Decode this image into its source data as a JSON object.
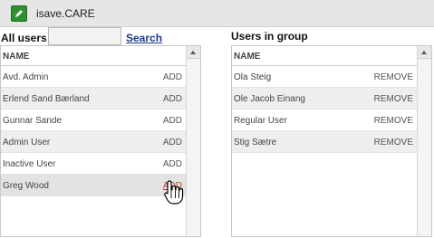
{
  "app": {
    "title": "isave.CARE",
    "icon": "pencil-icon",
    "accent": "#2f8f2f"
  },
  "all_users": {
    "label": "All users",
    "search": {
      "value": "",
      "placeholder": ""
    },
    "search_link": "Search",
    "column_header": "NAME",
    "rows": [
      {
        "name": "Avd. Admin",
        "action": "ADD"
      },
      {
        "name": "Erlend Sand Bærland",
        "action": "ADD"
      },
      {
        "name": "Gunnar Sande",
        "action": "ADD"
      },
      {
        "name": "Admin User",
        "action": "ADD"
      },
      {
        "name": "Inactive User",
        "action": "ADD"
      },
      {
        "name": "Greg Wood",
        "action": "ADD"
      }
    ]
  },
  "group_users": {
    "label": "Users in group",
    "column_header": "NAME",
    "rows": [
      {
        "name": "Ola Steig",
        "action": "REMOVE"
      },
      {
        "name": "Ole Jacob Einang",
        "action": "REMOVE"
      },
      {
        "name": "Regular User",
        "action": "REMOVE"
      },
      {
        "name": "Stig Sætre",
        "action": "REMOVE"
      }
    ]
  }
}
